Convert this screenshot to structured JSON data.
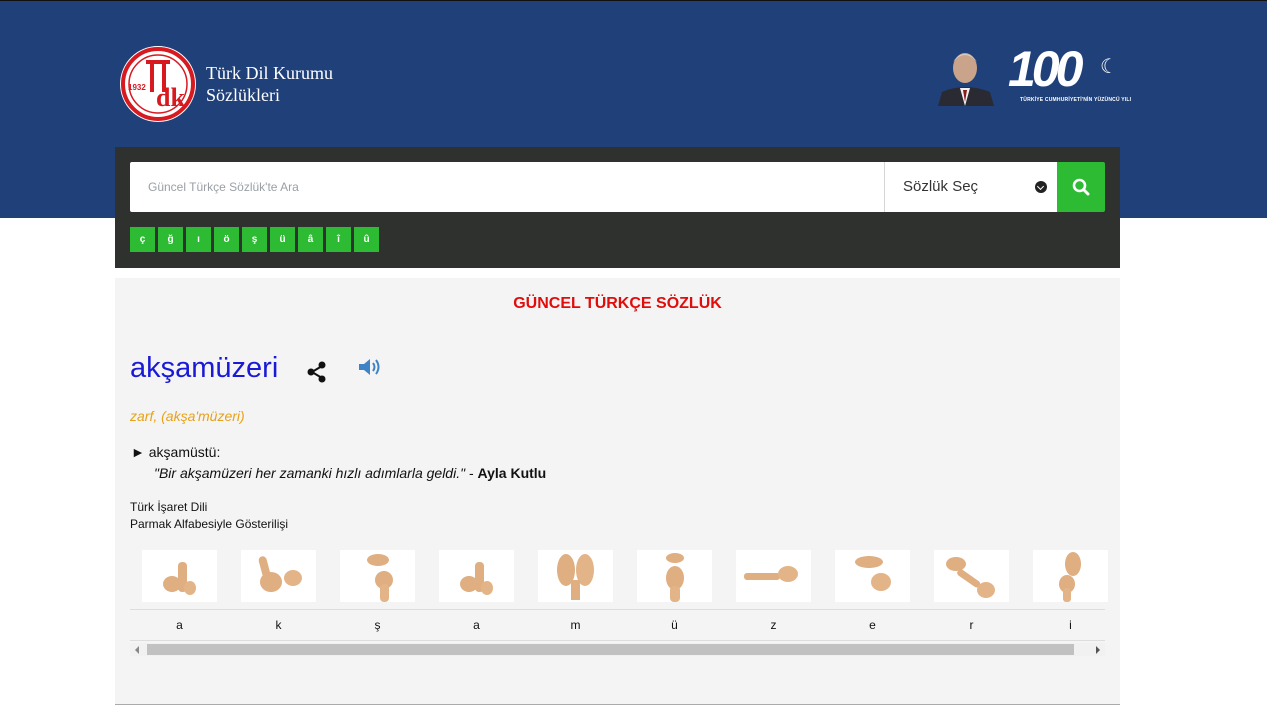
{
  "header": {
    "title_line1": "Türk Dil Kurumu",
    "title_line2": "Sözlükleri",
    "logo_year": "1932",
    "centennial_number": "100",
    "centennial_caption": "TÜRKİYE CUMHURİYETİ'NİN YÜZÜNCÜ YILI"
  },
  "search": {
    "placeholder": "Güncel Türkçe Sözlük'te Ara",
    "dictionary_select": "Sözlük Seç"
  },
  "special_chars": [
    "ç",
    "ğ",
    "ı",
    "ö",
    "ş",
    "ü",
    "â",
    "î",
    "û"
  ],
  "content": {
    "section_title": "GÜNCEL TÜRKÇE SÖZLÜK",
    "headword": "akşamüzeri",
    "part_of_speech": "zarf, (akşa'müzeri)",
    "definition": "► akşamüstü:",
    "example_quote": "\"Bir akşamüzeri her zamanki hızlı adımlarla geldi.\"",
    "example_sep": " - ",
    "example_author": "Ayla Kutlu",
    "sign_label_line1": "Türk İşaret Dili",
    "sign_label_line2": "Parmak Alfabesiyle Gösterilişi",
    "sign_letters": [
      "a",
      "k",
      "ş",
      "a",
      "m",
      "ü",
      "z",
      "e",
      "r",
      "i"
    ]
  },
  "colors": {
    "header_bg": "#1f4079",
    "panel_bg": "#2e312e",
    "accent_green": "#2dbb34",
    "title_red": "#e10c0c",
    "headword_blue": "#1a1ad6",
    "pos_orange": "#e8a216"
  }
}
